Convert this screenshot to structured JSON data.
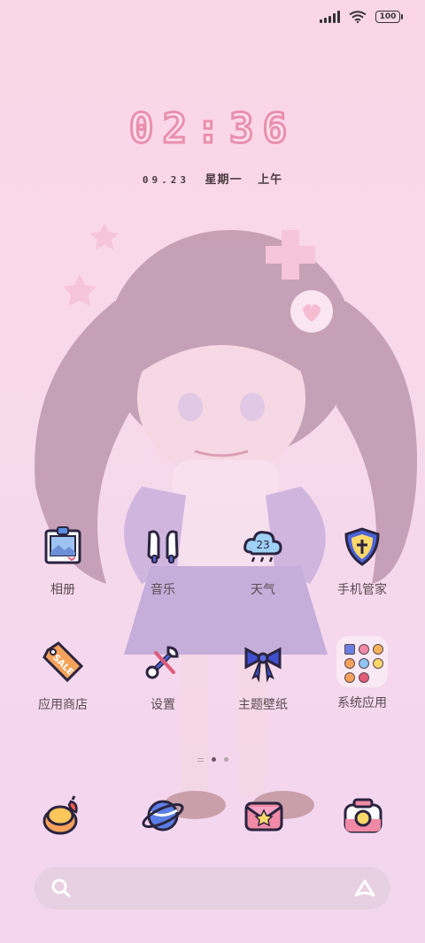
{
  "status_bar": {
    "battery": "100"
  },
  "lock": {
    "time": "02:36",
    "date": "09.23",
    "weekday": "星期一",
    "period": "上午"
  },
  "apps": [
    {
      "label": "相册",
      "icon": "photo-album-icon"
    },
    {
      "label": "音乐",
      "icon": "headphones-icon"
    },
    {
      "label": "天气",
      "icon": "weather-cloud-icon",
      "badge": "23"
    },
    {
      "label": "手机管家",
      "icon": "shield-icon"
    },
    {
      "label": "应用商店",
      "icon": "sale-tag-icon"
    },
    {
      "label": "设置",
      "icon": "tools-icon"
    },
    {
      "label": "主题壁纸",
      "icon": "ribbon-bow-icon"
    },
    {
      "label": "系统应用",
      "icon": "folder-icon"
    }
  ],
  "page_indicator": {
    "pages": 2,
    "current": 1
  },
  "dock": [
    "phone-icon",
    "browser-icon",
    "messages-icon",
    "camera-icon"
  ],
  "colors": {
    "accent": "#e98fae",
    "background": "#fbd6e6"
  }
}
